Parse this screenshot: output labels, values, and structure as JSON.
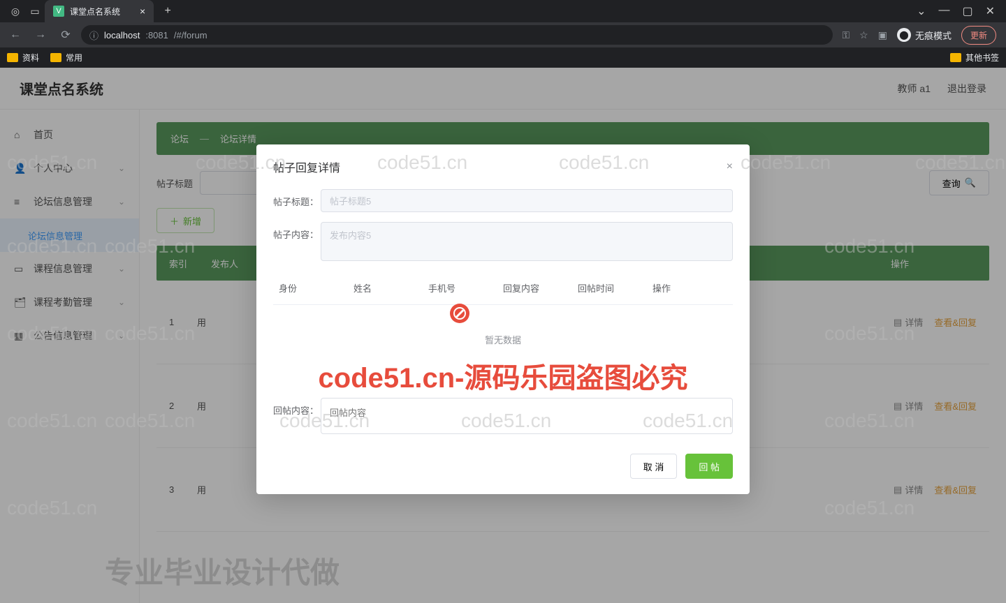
{
  "browser": {
    "tab_title": "课堂点名系统",
    "new_tab": "+",
    "window": {
      "min": "—",
      "max": "▢",
      "close": "✕",
      "dropdown": "⌄"
    },
    "nav": {
      "back": "←",
      "forward": "→",
      "reload": "⟳",
      "info": "ⓘ"
    },
    "url_host": "localhost",
    "url_port": ":8081",
    "url_path": "/#/forum",
    "key_icon": "⚿",
    "star_icon": "☆",
    "ext_icon": "▣",
    "incognito_label": "无痕模式",
    "update_label": "更新",
    "bookmarks": {
      "a": "资料",
      "b": "常用",
      "other": "其他书签"
    }
  },
  "app": {
    "title": "课堂点名系统",
    "user": "教师 a1",
    "logout": "退出登录"
  },
  "sidebar": {
    "items": [
      {
        "label": "首页",
        "icon": "⌂"
      },
      {
        "label": "个人中心",
        "icon": "👤",
        "expand": true
      },
      {
        "label": "论坛信息管理",
        "icon": "≡",
        "expand": true
      },
      {
        "label": "论坛信息管理",
        "sub": true,
        "active": true
      },
      {
        "label": "课程信息管理",
        "icon": "▭",
        "expand": true
      },
      {
        "label": "课程考勤管理",
        "icon": "🗂",
        "expand": true
      },
      {
        "label": "公告信息管理",
        "icon": "▦",
        "expand": true
      }
    ]
  },
  "breadcrumb": {
    "a": "论坛",
    "sep": "—",
    "b": "论坛详情"
  },
  "search": {
    "label": "帖子标题",
    "query_btn": "查询"
  },
  "add_btn": "新增",
  "table_head": {
    "idx": "索引",
    "user": "发布人",
    "ops": "操作"
  },
  "rows": [
    {
      "idx": "1",
      "user": "用",
      "detail": "详情",
      "reply": "查看&回复"
    },
    {
      "idx": "2",
      "user": "用",
      "detail": "详情",
      "reply": "查看&回复"
    },
    {
      "idx": "3",
      "user": "用",
      "detail": "详情",
      "reply": "查看&回复"
    }
  ],
  "modal": {
    "title": "帖子回复详情",
    "title_label": "帖子标题：",
    "title_value": "帖子标题5",
    "content_label": "帖子内容：",
    "content_value": "发布内容5",
    "cols": {
      "role": "身份",
      "name": "姓名",
      "phone": "手机号",
      "content": "回复内容",
      "time": "回帖时间",
      "ops": "操作"
    },
    "no_data": "暂无数据",
    "reply_label": "回帖内容：",
    "reply_placeholder": "回帖内容",
    "cancel": "取 消",
    "submit": "回 帖"
  },
  "watermark": {
    "text": "code51.cn",
    "red": "code51.cn-源码乐园盗图必究",
    "gray": "专业毕业设计代做"
  }
}
